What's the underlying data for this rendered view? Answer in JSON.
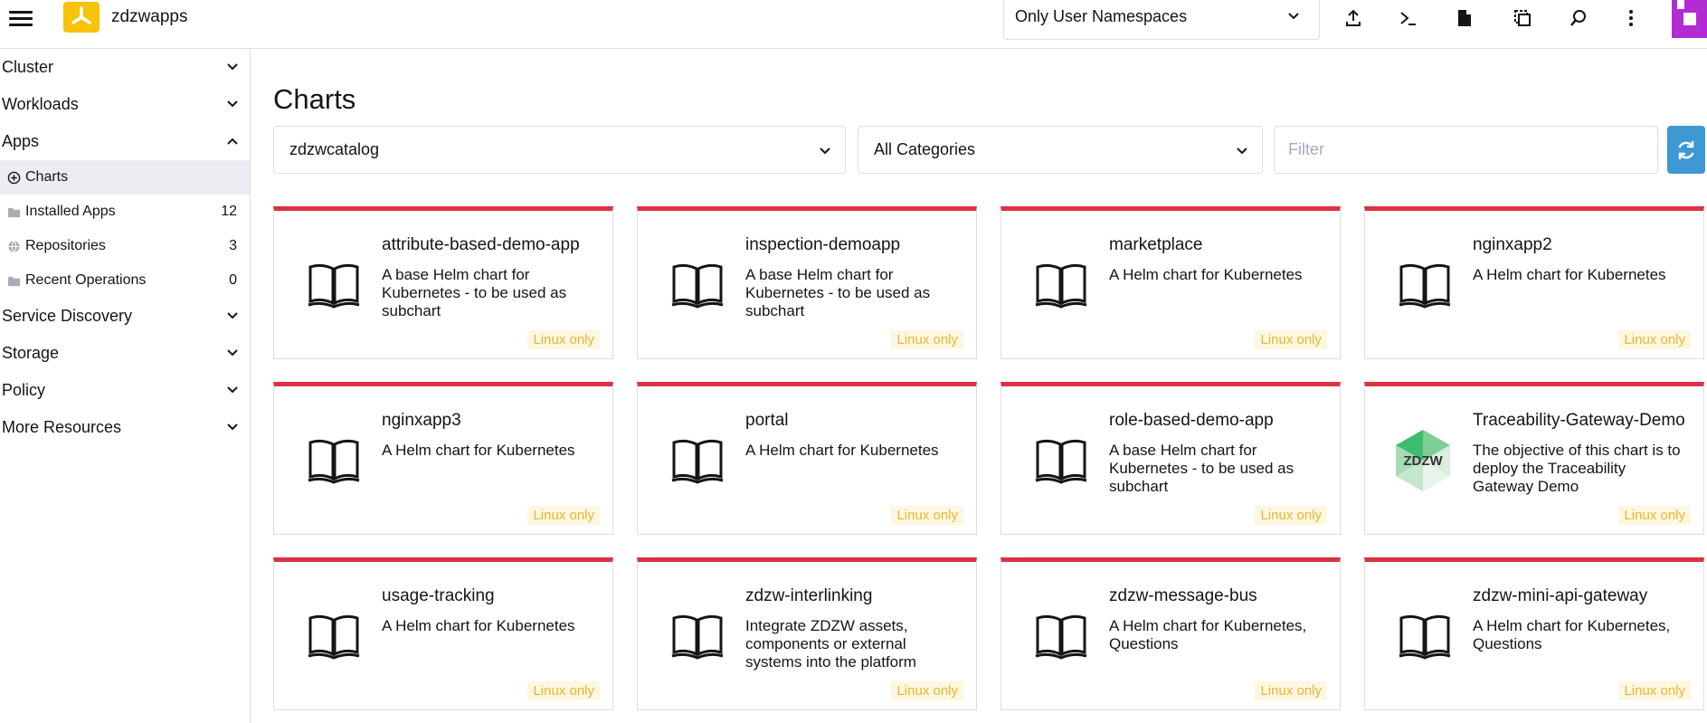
{
  "header": {
    "app_name": "zdzwapps",
    "namespace_filter": "Only User Namespaces",
    "icons": [
      "menu-icon",
      "upload-icon",
      "terminal-icon",
      "file-icon",
      "copy-icon",
      "search-icon",
      "more-vertical-icon"
    ]
  },
  "sidebar": {
    "groups": [
      {
        "label": "Cluster",
        "expanded": false
      },
      {
        "label": "Workloads",
        "expanded": false
      },
      {
        "label": "Apps",
        "expanded": true
      },
      {
        "label": "Service Discovery",
        "expanded": false
      },
      {
        "label": "Storage",
        "expanded": false
      },
      {
        "label": "Policy",
        "expanded": false
      },
      {
        "label": "More Resources",
        "expanded": false
      }
    ],
    "apps_children": [
      {
        "label": "Charts",
        "count": "",
        "icon": "plus-circle-icon",
        "active": true
      },
      {
        "label": "Installed Apps",
        "count": "12",
        "icon": "folder-icon",
        "active": false
      },
      {
        "label": "Repositories",
        "count": "3",
        "icon": "globe-icon",
        "active": false
      },
      {
        "label": "Recent Operations",
        "count": "0",
        "icon": "folder-icon",
        "active": false
      }
    ]
  },
  "main": {
    "title": "Charts",
    "repo_select": "zdzwcatalog",
    "category_select": "All Categories",
    "filter_placeholder": "Filter"
  },
  "cards": [
    {
      "name": "attribute-based-demo-app",
      "desc": "A base Helm chart for Kubernetes - to be used as subchart",
      "badge": "Linux only",
      "icon": "book-icon"
    },
    {
      "name": "inspection-demoapp",
      "desc": "A base Helm chart for Kubernetes - to be used as subchart",
      "badge": "Linux only",
      "icon": "book-icon"
    },
    {
      "name": "marketplace",
      "desc": "A Helm chart for Kubernetes",
      "badge": "Linux only",
      "icon": "book-icon"
    },
    {
      "name": "nginxapp2",
      "desc": "A Helm chart for Kubernetes",
      "badge": "Linux only",
      "icon": "book-icon"
    },
    {
      "name": "nginxapp3",
      "desc": "A Helm chart for Kubernetes",
      "badge": "Linux only",
      "icon": "book-icon"
    },
    {
      "name": "portal",
      "desc": "A Helm chart for Kubernetes",
      "badge": "Linux only",
      "icon": "book-icon"
    },
    {
      "name": "role-based-demo-app",
      "desc": "A base Helm chart for Kubernetes - to be used as subchart",
      "badge": "Linux only",
      "icon": "book-icon"
    },
    {
      "name": "Traceability-Gateway-Demo",
      "desc": "The objective of this chart is to deploy the Traceability Gateway Demo",
      "badge": "Linux only",
      "icon": "zdzw-logo",
      "logo_text": "ZDZW"
    },
    {
      "name": "usage-tracking",
      "desc": "A Helm chart for Kubernetes",
      "badge": "Linux only",
      "icon": "book-icon"
    },
    {
      "name": "zdzw-interlinking",
      "desc": "Integrate ZDZW assets, components or external systems into the platform",
      "badge": "Linux only",
      "icon": "book-icon"
    },
    {
      "name": "zdzw-message-bus",
      "desc": "A Helm chart for Kubernetes, Questions",
      "badge": "Linux only",
      "icon": "book-icon"
    },
    {
      "name": "zdzw-mini-api-gateway",
      "desc": "A Helm chart for Kubernetes, Questions",
      "badge": "Linux only",
      "icon": "book-icon"
    }
  ],
  "colors": {
    "accent": "#dd3243",
    "refresh": "#3d98d3",
    "badge_bg": "#fdf7df",
    "badge_text": "#e2b737",
    "logo": "#f7c20a",
    "avatar": "#b32bd2"
  }
}
